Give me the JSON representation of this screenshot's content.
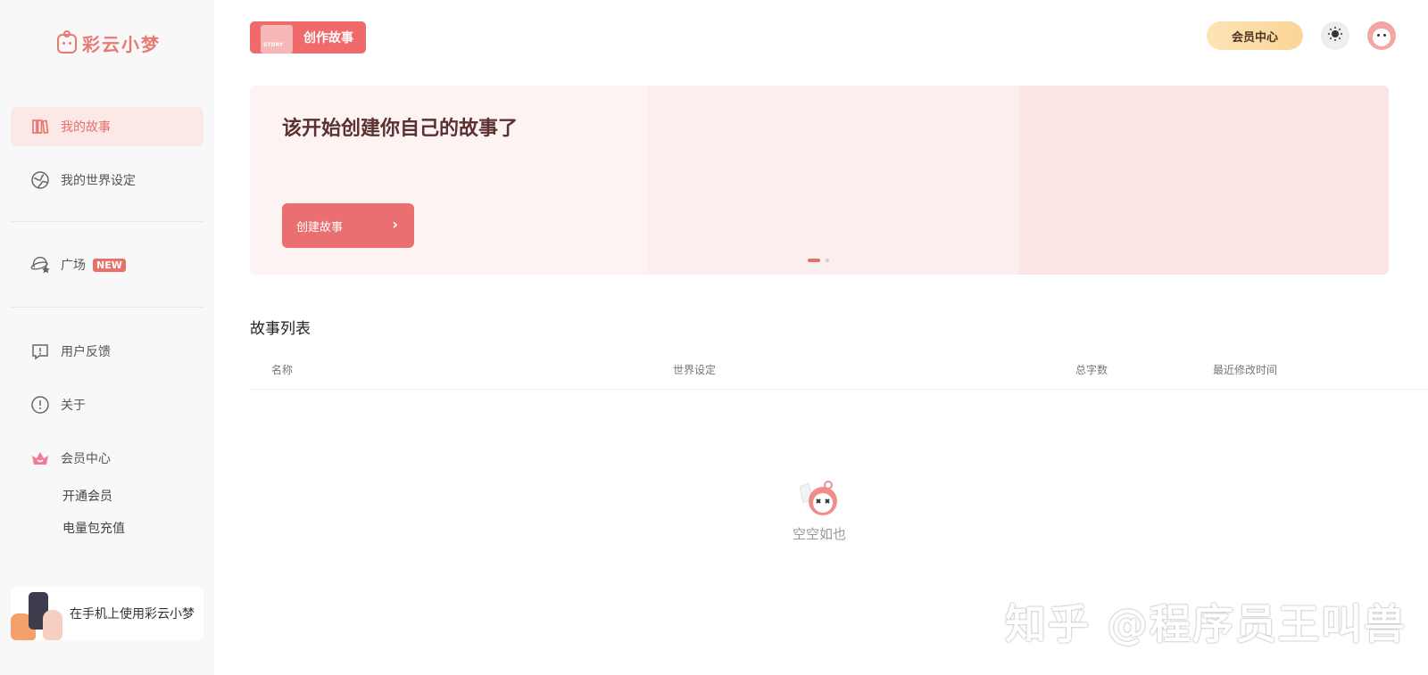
{
  "app": {
    "logo_text": "彩云小梦"
  },
  "sidebar": {
    "items": [
      {
        "label": "我的故事",
        "active": true
      },
      {
        "label": "我的世界设定"
      },
      {
        "label": "广场",
        "badge": "NEW"
      },
      {
        "label": "用户反馈"
      },
      {
        "label": "关于"
      },
      {
        "label": "会员中心"
      }
    ],
    "vip_sub": [
      "开通会员",
      "电量包充值"
    ],
    "promo_text": "在手机上使用彩云小梦"
  },
  "header": {
    "create_story_label": "创作故事",
    "story_badge": "STORY",
    "vip_center_label": "会员中心"
  },
  "banner": {
    "title": "该开始创建你自己的故事了",
    "button_label": "创建故事",
    "slides": 2,
    "active_slide": 1
  },
  "story_list": {
    "title": "故事列表",
    "columns": [
      "名称",
      "世界设定",
      "总字数",
      "最近修改时间"
    ],
    "empty_text": "空空如也",
    "rows": []
  },
  "watermark": "知乎 @程序员王叫兽",
  "colors": {
    "accent": "#ea6f70",
    "sidebar_bg": "#f8f8f8",
    "active_bg": "#fbe8e7",
    "vip_gold": "#fcd596"
  }
}
